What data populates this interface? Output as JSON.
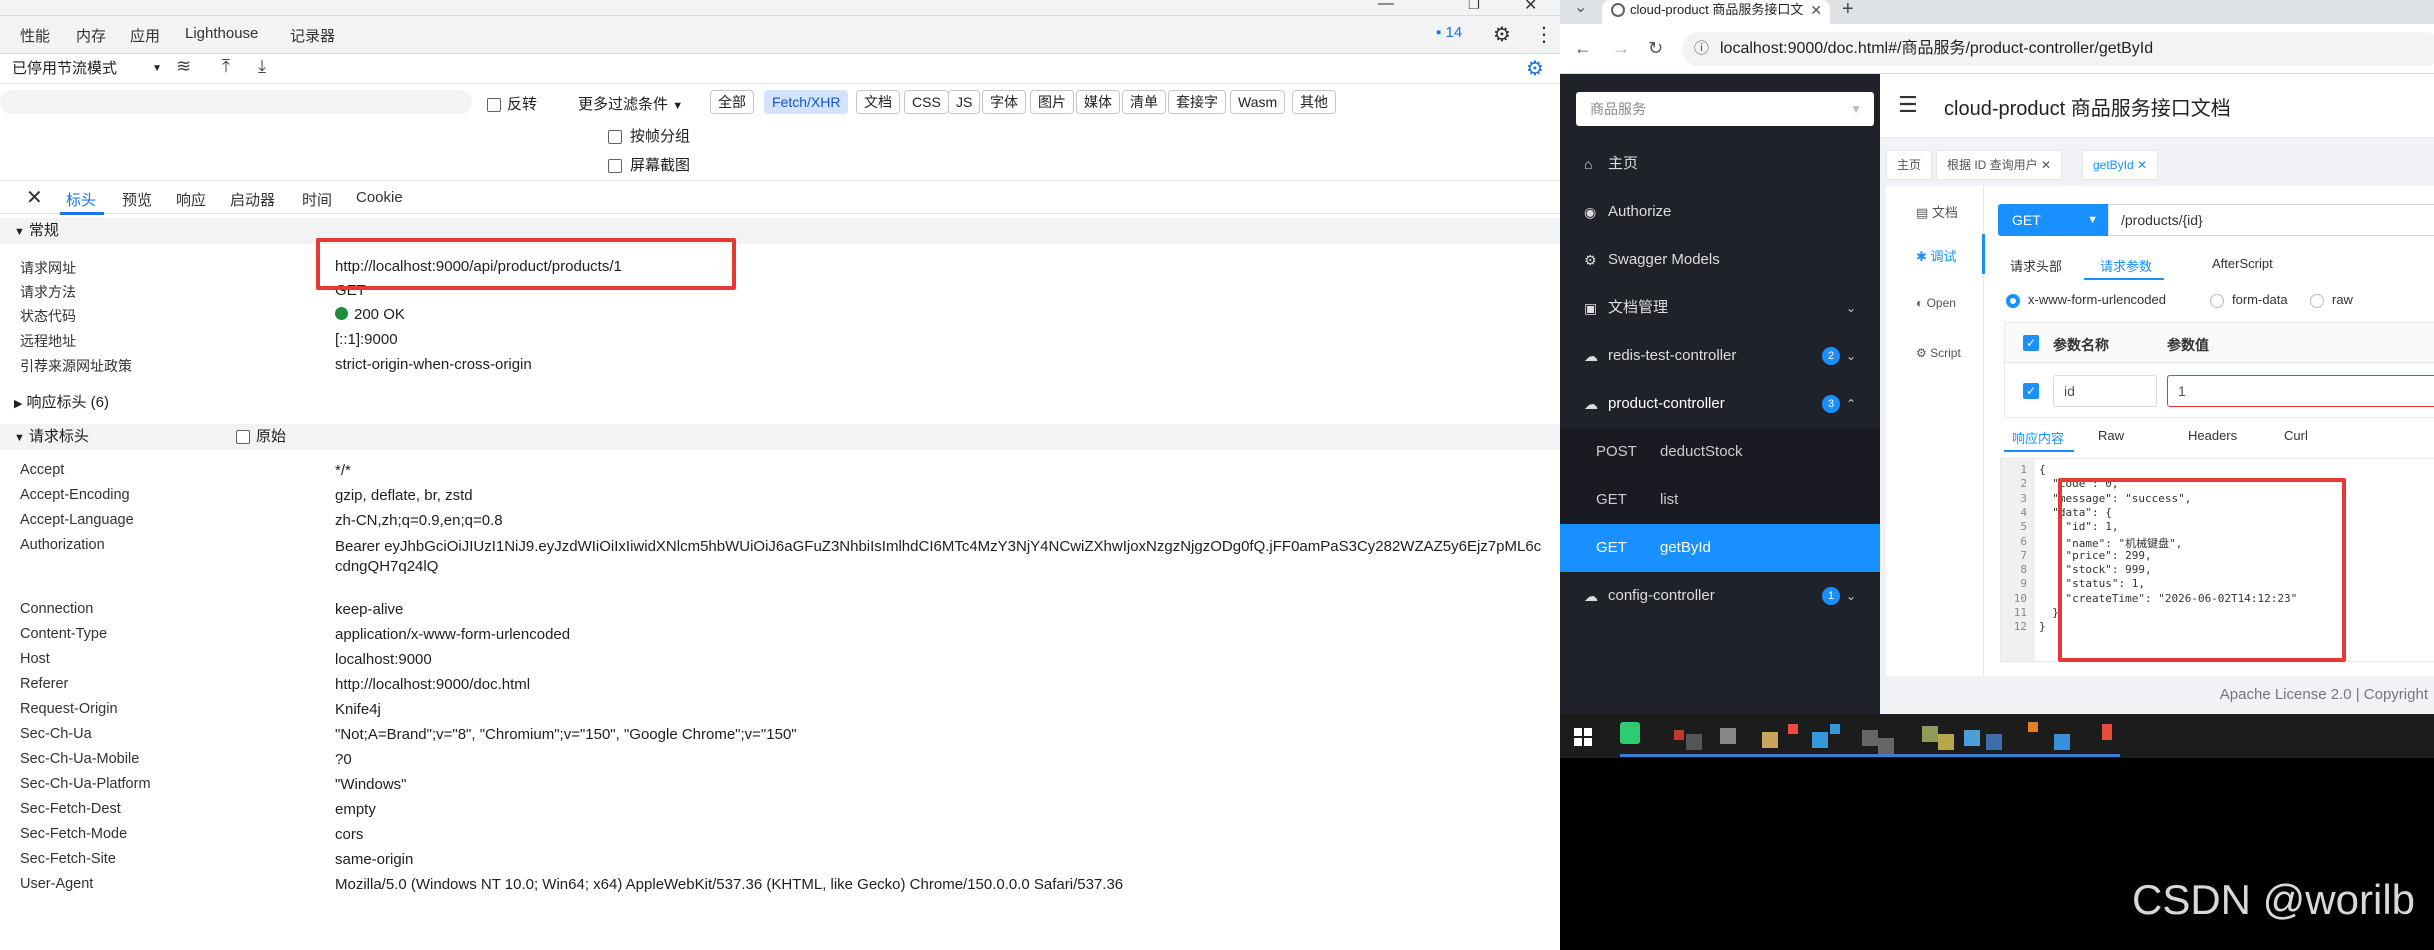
{
  "devtools": {
    "tabs": [
      "性能",
      "内存",
      "应用",
      "Lighthouse",
      "记录器"
    ],
    "issues_count": "14",
    "throttle": "已停用节流模式",
    "filter": {
      "invert_label": "反转",
      "more_filters": "更多过滤条件",
      "chips": [
        "全部",
        "Fetch/XHR",
        "文档",
        "CSS",
        "JS",
        "字体",
        "图片",
        "媒体",
        "清单",
        "套接字",
        "Wasm",
        "其他"
      ],
      "active_chip": "Fetch/XHR"
    },
    "options": {
      "group_by_frame": "按帧分组",
      "screenshot": "屏幕截图"
    },
    "panel_tabs": [
      "标头",
      "预览",
      "响应",
      "启动器",
      "时间",
      "Cookie"
    ],
    "general": {
      "title": "常规",
      "rows": [
        {
          "name": "请求网址",
          "value": "http://localhost:9000/api/product/products/1"
        },
        {
          "name": "请求方法",
          "value": "GET"
        },
        {
          "name": "状态代码",
          "value": "200 OK"
        },
        {
          "name": "远程地址",
          "value": "[::1]:9000"
        },
        {
          "name": "引荐来源网址政策",
          "value": "strict-origin-when-cross-origin"
        }
      ]
    },
    "response_headers": {
      "title": "响应标头 (6)"
    },
    "request_headers": {
      "title": "请求标头",
      "raw_label": "原始",
      "rows": [
        {
          "name": "Accept",
          "value": "*/*"
        },
        {
          "name": "Accept-Encoding",
          "value": "gzip, deflate, br, zstd"
        },
        {
          "name": "Accept-Language",
          "value": "zh-CN,zh;q=0.9,en;q=0.8"
        },
        {
          "name": "Authorization",
          "value": "Bearer eyJhbGciOiJIUzI1NiJ9.eyJzdWIiOiIxIiwidXNlcm5hbWUiOiJ6aGFuZ3NhbiIsImlhdCI6MTc4MzY3NjY4NCwiZXhwIjoxNzgzNjgzODg0fQ.jFF0amPaS3Cy282WZAZ5y6Ejz7pML6ccdngQH7q24lQ"
        },
        {
          "name": "Connection",
          "value": "keep-alive"
        },
        {
          "name": "Content-Type",
          "value": "application/x-www-form-urlencoded"
        },
        {
          "name": "Host",
          "value": "localhost:9000"
        },
        {
          "name": "Referer",
          "value": "http://localhost:9000/doc.html"
        },
        {
          "name": "Request-Origin",
          "value": "Knife4j"
        },
        {
          "name": "Sec-Ch-Ua",
          "value": "\"Not;A=Brand\";v=\"8\", \"Chromium\";v=\"150\", \"Google Chrome\";v=\"150\""
        },
        {
          "name": "Sec-Ch-Ua-Mobile",
          "value": "?0"
        },
        {
          "name": "Sec-Ch-Ua-Platform",
          "value": "\"Windows\""
        },
        {
          "name": "Sec-Fetch-Dest",
          "value": "empty"
        },
        {
          "name": "Sec-Fetch-Mode",
          "value": "cors"
        },
        {
          "name": "Sec-Fetch-Site",
          "value": "same-origin"
        },
        {
          "name": "User-Agent",
          "value": "Mozilla/5.0 (Windows NT 10.0; Win64; x64) AppleWebKit/537.36 (KHTML, like Gecko) Chrome/150.0.0.0 Safari/537.36"
        }
      ]
    }
  },
  "browser": {
    "tab_title": "cloud-product 商品服务接口文",
    "url": "localhost:9000/doc.html#/商品服务/product-controller/getById"
  },
  "knife4j": {
    "group_select": "商品服务",
    "menu": {
      "home": "主页",
      "authorize": "Authorize",
      "swagger_models": "Swagger Models",
      "doc_manage": "文档管理",
      "redis": {
        "label": "redis-test-controller",
        "count": "2"
      },
      "product": {
        "label": "product-controller",
        "count": "3"
      },
      "endpoints": [
        {
          "method": "POST",
          "path": "deductStock"
        },
        {
          "method": "GET",
          "path": "list"
        },
        {
          "method": "GET",
          "path": "getById"
        }
      ],
      "config": {
        "label": "config-controller",
        "count": "1"
      }
    },
    "title": "cloud-product 商品服务接口文档",
    "tabs": [
      "主页",
      "根据 ID 查询用户",
      "getById"
    ],
    "left_nav": [
      "文档",
      "调试",
      "Open",
      "Script"
    ],
    "request": {
      "method": "GET",
      "path": "/products/{id}"
    },
    "sub_tabs": [
      "请求头部",
      "请求参数",
      "AfterScript"
    ],
    "content_types": [
      "x-www-form-urlencoded",
      "form-data",
      "raw"
    ],
    "param_headers": {
      "name": "参数名称",
      "value": "参数值"
    },
    "param": {
      "name": "id",
      "value": "1"
    },
    "response_tabs": [
      "响应内容",
      "Raw",
      "Headers",
      "Curl"
    ],
    "response_lines": [
      {
        "no": "1",
        "text": "{"
      },
      {
        "no": "2",
        "text": "  \"code\": 0,"
      },
      {
        "no": "3",
        "text": "  \"message\": \"success\","
      },
      {
        "no": "4",
        "text": "  \"data\": {"
      },
      {
        "no": "5",
        "text": "    \"id\": 1,"
      },
      {
        "no": "6",
        "text": "    \"name\": \"机械键盘\","
      },
      {
        "no": "7",
        "text": "    \"price\": 299,"
      },
      {
        "no": "8",
        "text": "    \"stock\": 999,"
      },
      {
        "no": "9",
        "text": "    \"status\": 1,"
      },
      {
        "no": "10",
        "text": "    \"createTime\": \"2026-06-02T14:12:23\""
      },
      {
        "no": "11",
        "text": "  }"
      },
      {
        "no": "12",
        "text": "}"
      }
    ],
    "footer": "Apache License 2.0 | Copyright"
  },
  "watermark": "CSDN @worilb",
  "colors": {
    "accent": "#1a73e8",
    "knife_blue": "#1890ff",
    "highlight": "#e53935",
    "sidebar": "#20222a"
  }
}
